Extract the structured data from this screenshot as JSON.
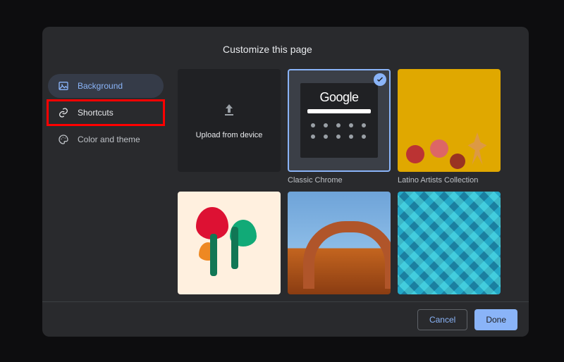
{
  "dialog": {
    "title": "Customize this page"
  },
  "sidebar": {
    "items": [
      {
        "label": "Background"
      },
      {
        "label": "Shortcuts"
      },
      {
        "label": "Color and theme"
      }
    ]
  },
  "tiles": {
    "upload": {
      "label": "Upload from device"
    },
    "classic": {
      "caption": "Classic Chrome",
      "logo": "Google"
    },
    "latino": {
      "caption": "Latino Artists Collection"
    }
  },
  "footer": {
    "cancel": "Cancel",
    "done": "Done"
  }
}
